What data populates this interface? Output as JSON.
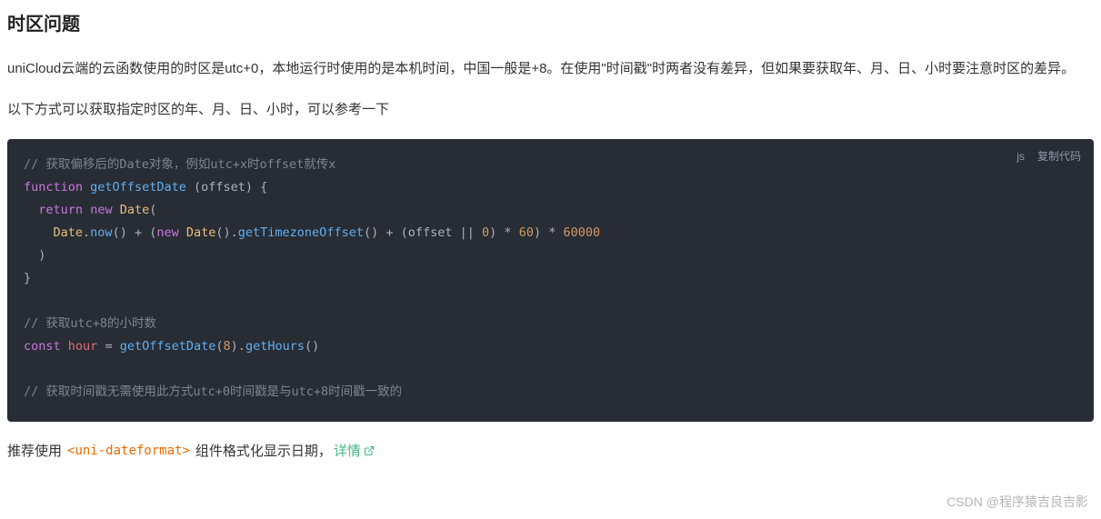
{
  "heading": "时区问题",
  "para1": "uniCloud云端的云函数使用的时区是utc+0，本地运行时使用的是本机时间，中国一般是+8。在使用\"时间戳\"时两者没有差异，但如果要获取年、月、日、小时要注意时区的差异。",
  "para2": "以下方式可以获取指定时区的年、月、日、小时，可以参考一下",
  "code": {
    "lang": "js",
    "copy_label": "复制代码",
    "comment1": "// 获取偏移后的Date对象，例如utc+x时offset就传x",
    "kw_function": "function",
    "fn_name": "getOffsetDate",
    "param": "offset",
    "kw_return": "return",
    "kw_new1": "new",
    "class_date1": "Date",
    "class_date2": "Date",
    "method_now": "now",
    "kw_new2": "new",
    "class_date3": "Date",
    "method_gto": "getTimezoneOffset",
    "param_ref": "offset",
    "num_0": "0",
    "num_60": "60",
    "num_60000": "60000",
    "comment2": "// 获取utc+8的小时数",
    "kw_const": "const",
    "var_hour": "hour",
    "fn_call": "getOffsetDate",
    "num_8": "8",
    "method_gethours": "getHours",
    "comment3": "// 获取时间戳无需使用此方式utc+0时间戳是与utc+8时间戳一致的"
  },
  "footer": {
    "prefix": "推荐使用 ",
    "inline_code": "<uni-dateformat>",
    "middle": " 组件格式化显示日期，",
    "link_text": "详情"
  },
  "watermark": "CSDN @程序猿吉良吉影"
}
